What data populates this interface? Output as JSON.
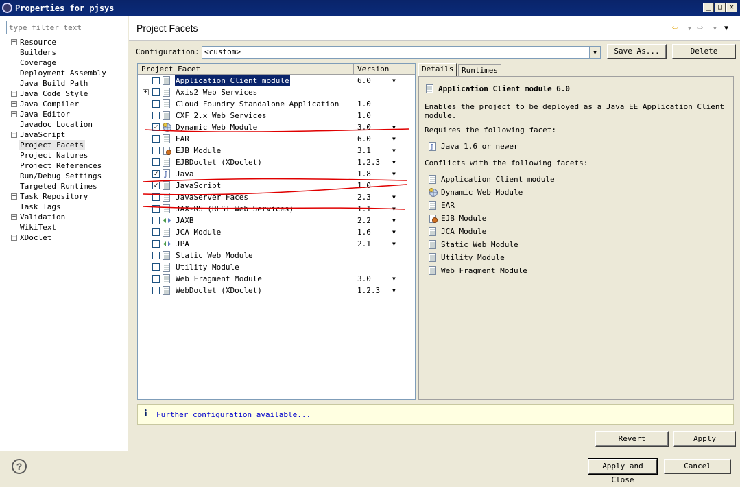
{
  "window": {
    "title": "Properties for pjsys"
  },
  "filter": {
    "placeholder": "type filter text"
  },
  "tree": [
    {
      "label": "Resource",
      "expandable": true
    },
    {
      "label": "Builders",
      "expandable": false
    },
    {
      "label": "Coverage",
      "expandable": false
    },
    {
      "label": "Deployment Assembly",
      "expandable": false
    },
    {
      "label": "Java Build Path",
      "expandable": false
    },
    {
      "label": "Java Code Style",
      "expandable": true
    },
    {
      "label": "Java Compiler",
      "expandable": true
    },
    {
      "label": "Java Editor",
      "expandable": true
    },
    {
      "label": "Javadoc Location",
      "expandable": false
    },
    {
      "label": "JavaScript",
      "expandable": true
    },
    {
      "label": "Project Facets",
      "expandable": false,
      "selected": true
    },
    {
      "label": "Project Natures",
      "expandable": false
    },
    {
      "label": "Project References",
      "expandable": false
    },
    {
      "label": "Run/Debug Settings",
      "expandable": false
    },
    {
      "label": "Targeted Runtimes",
      "expandable": false
    },
    {
      "label": "Task Repository",
      "expandable": true
    },
    {
      "label": "Task Tags",
      "expandable": false
    },
    {
      "label": "Validation",
      "expandable": true
    },
    {
      "label": "WikiText",
      "expandable": false
    },
    {
      "label": "XDoclet",
      "expandable": true
    }
  ],
  "page": {
    "title": "Project Facets"
  },
  "config": {
    "label": "Configuration:",
    "value": "<custom>",
    "save_as": "Save As...",
    "delete": "Delete"
  },
  "table": {
    "col_facet": "Project Facet",
    "col_version": "Version",
    "rows": [
      {
        "name": "Application Client module",
        "version": "6.0",
        "checked": false,
        "dropdown": true,
        "selected": true,
        "icon": "page"
      },
      {
        "name": "Axis2 Web Services",
        "version": "",
        "checked": false,
        "dropdown": false,
        "expandable": true,
        "icon": "page"
      },
      {
        "name": "Cloud Foundry Standalone Application",
        "version": "1.0",
        "checked": false,
        "dropdown": false,
        "icon": "page"
      },
      {
        "name": "CXF 2.x Web Services",
        "version": "1.0",
        "checked": false,
        "dropdown": false,
        "icon": "page"
      },
      {
        "name": "Dynamic Web Module",
        "version": "3.0",
        "checked": true,
        "dropdown": true,
        "icon": "globe"
      },
      {
        "name": "EAR",
        "version": "6.0",
        "checked": false,
        "dropdown": true,
        "icon": "page"
      },
      {
        "name": "EJB Module",
        "version": "3.1",
        "checked": false,
        "dropdown": true,
        "icon": "bean"
      },
      {
        "name": "EJBDoclet (XDoclet)",
        "version": "1.2.3",
        "checked": false,
        "dropdown": true,
        "icon": "page"
      },
      {
        "name": "Java",
        "version": "1.8",
        "checked": true,
        "dropdown": true,
        "icon": "java"
      },
      {
        "name": "JavaScript",
        "version": "1.0",
        "checked": true,
        "dropdown": false,
        "icon": "page"
      },
      {
        "name": "JavaServer Faces",
        "version": "2.3",
        "checked": false,
        "dropdown": true,
        "icon": "page"
      },
      {
        "name": "JAX-RS (REST Web Services)",
        "version": "1.1",
        "checked": false,
        "dropdown": true,
        "icon": "page"
      },
      {
        "name": "JAXB",
        "version": "2.2",
        "checked": false,
        "dropdown": true,
        "icon": "arrows"
      },
      {
        "name": "JCA Module",
        "version": "1.6",
        "checked": false,
        "dropdown": true,
        "icon": "page"
      },
      {
        "name": "JPA",
        "version": "2.1",
        "checked": false,
        "dropdown": true,
        "icon": "arrows"
      },
      {
        "name": "Static Web Module",
        "version": "",
        "checked": false,
        "dropdown": false,
        "icon": "page"
      },
      {
        "name": "Utility Module",
        "version": "",
        "checked": false,
        "dropdown": false,
        "icon": "page"
      },
      {
        "name": "Web Fragment Module",
        "version": "3.0",
        "checked": false,
        "dropdown": true,
        "icon": "page"
      },
      {
        "name": "WebDoclet (XDoclet)",
        "version": "1.2.3",
        "checked": false,
        "dropdown": true,
        "icon": "page"
      }
    ]
  },
  "details": {
    "tab_details": "Details",
    "tab_runtimes": "Runtimes",
    "heading": "Application Client module 6.0",
    "desc_line1": "Enables the project to be deployed as a Java EE Application Client",
    "desc_line2": "module.",
    "requires_label": "Requires the following facet:",
    "requires": [
      {
        "name": "Java 1.6 or newer",
        "icon": "java"
      }
    ],
    "conflicts_label": "Conflicts with the following facets:",
    "conflicts": [
      {
        "name": "Application Client module",
        "icon": "page"
      },
      {
        "name": "Dynamic Web Module",
        "icon": "globe"
      },
      {
        "name": "EAR",
        "icon": "page"
      },
      {
        "name": "EJB Module",
        "icon": "bean"
      },
      {
        "name": "JCA Module",
        "icon": "page"
      },
      {
        "name": "Static Web Module",
        "icon": "page"
      },
      {
        "name": "Utility Module",
        "icon": "page"
      },
      {
        "name": "Web Fragment Module",
        "icon": "page"
      }
    ]
  },
  "info": {
    "link": "Further configuration available..."
  },
  "buttons": {
    "revert": "Revert",
    "apply": "Apply",
    "apply_close": "Apply and Close",
    "cancel": "Cancel"
  },
  "colors": {
    "titlebar": "#0a246a",
    "selection": "#0a246a",
    "annotation": "#e00000",
    "infobar": "#ffffe1"
  }
}
